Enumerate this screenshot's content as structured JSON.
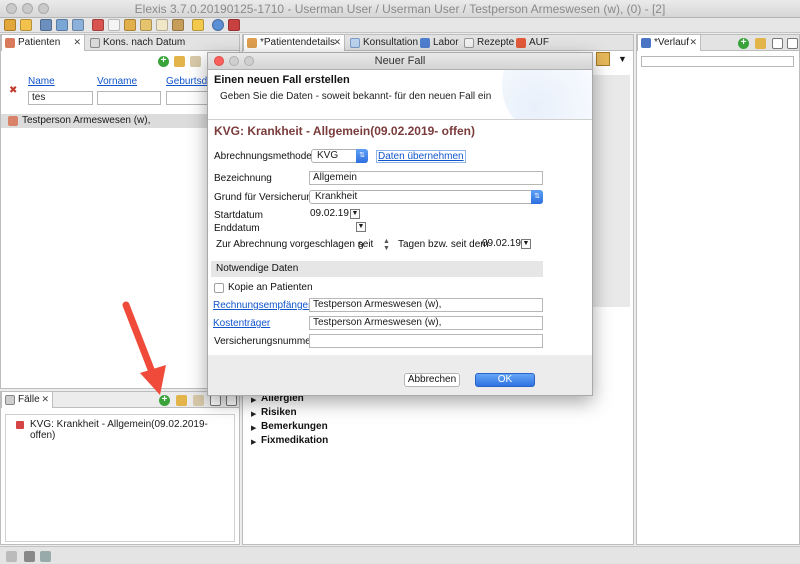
{
  "window": {
    "title": "Elexis 3.7.0.20190125-1710 - Userman User / Userman User / Testperson Armeswesen (w), (0) - [2]"
  },
  "left_panel": {
    "tabs": [
      {
        "label": "Patienten",
        "active": true
      },
      {
        "label": "Kons. nach Datum",
        "active": false
      }
    ],
    "columns": [
      "Name",
      "Vorname",
      "Geburtsdat"
    ],
    "filter_name_value": "tes",
    "results": [
      "Testperson Armeswesen (w),"
    ]
  },
  "faelle_panel": {
    "tab_label": "Fälle",
    "items": [
      "KVG: Krankheit - Allgemein(09.02.2019- offen)"
    ]
  },
  "center_panel": {
    "tabs": [
      {
        "label": "*Patientendetails",
        "active": true
      },
      {
        "label": "Konsultation",
        "active": false
      },
      {
        "label": "Labor",
        "active": false
      },
      {
        "label": "Rezepte",
        "active": false
      },
      {
        "label": "AUF",
        "active": false
      }
    ],
    "sections": [
      "Allergien",
      "Risiken",
      "Bemerkungen",
      "Fixmedikation"
    ]
  },
  "right_panel": {
    "tab_label": "*Verlauf"
  },
  "dialog": {
    "window_title": "Neuer Fall",
    "heading": "Einen neuen Fall erstellen",
    "subheading": "Geben Sie die Daten - soweit bekannt- für den neuen Fall ein",
    "case_title": "KVG: Krankheit - Allgemein(09.02.2019- offen)",
    "abrechnungsmethode_label": "Abrechnungsmethode",
    "abrechnungsmethode_value": "KVG",
    "daten_uebernehmen": "Daten übernehmen",
    "bezeichnung_label": "Bezeichnung",
    "bezeichnung_value": "Allgemein",
    "grund_label": "Grund für Versicherung",
    "grund_value": "Krankheit",
    "startdatum_label": "Startdatum",
    "startdatum_value": "09.02.19",
    "enddatum_label": "Enddatum",
    "abrechnung_label": "Zur Abrechnung vorgeschlagen seit",
    "abrechnung_value": "0",
    "tage_label": "Tagen bzw. seit dem",
    "tage_date": "09.02.19",
    "section_label": "Notwendige Daten",
    "kopie_label": "Kopie an Patienten",
    "rechnungsempfaenger_label": "Rechnungsempfänger",
    "rechnungsempfaenger_value": "Testperson Armeswesen (w),",
    "kostentraeger_label": "Kostenträger",
    "kostentraeger_value": "Testperson Armeswesen (w),",
    "versicherungsnummer_label": "Versicherungsnummer",
    "versicherungsnummer_value": "",
    "cancel_label": "Abbrechen",
    "ok_label": "OK"
  },
  "colors": {
    "case_title": "#7a3b3b",
    "link": "#1155cc",
    "accent_blue": "#2f73e1",
    "add_green": "#3aa33a",
    "annotation_arrow": "#f04a3a"
  }
}
